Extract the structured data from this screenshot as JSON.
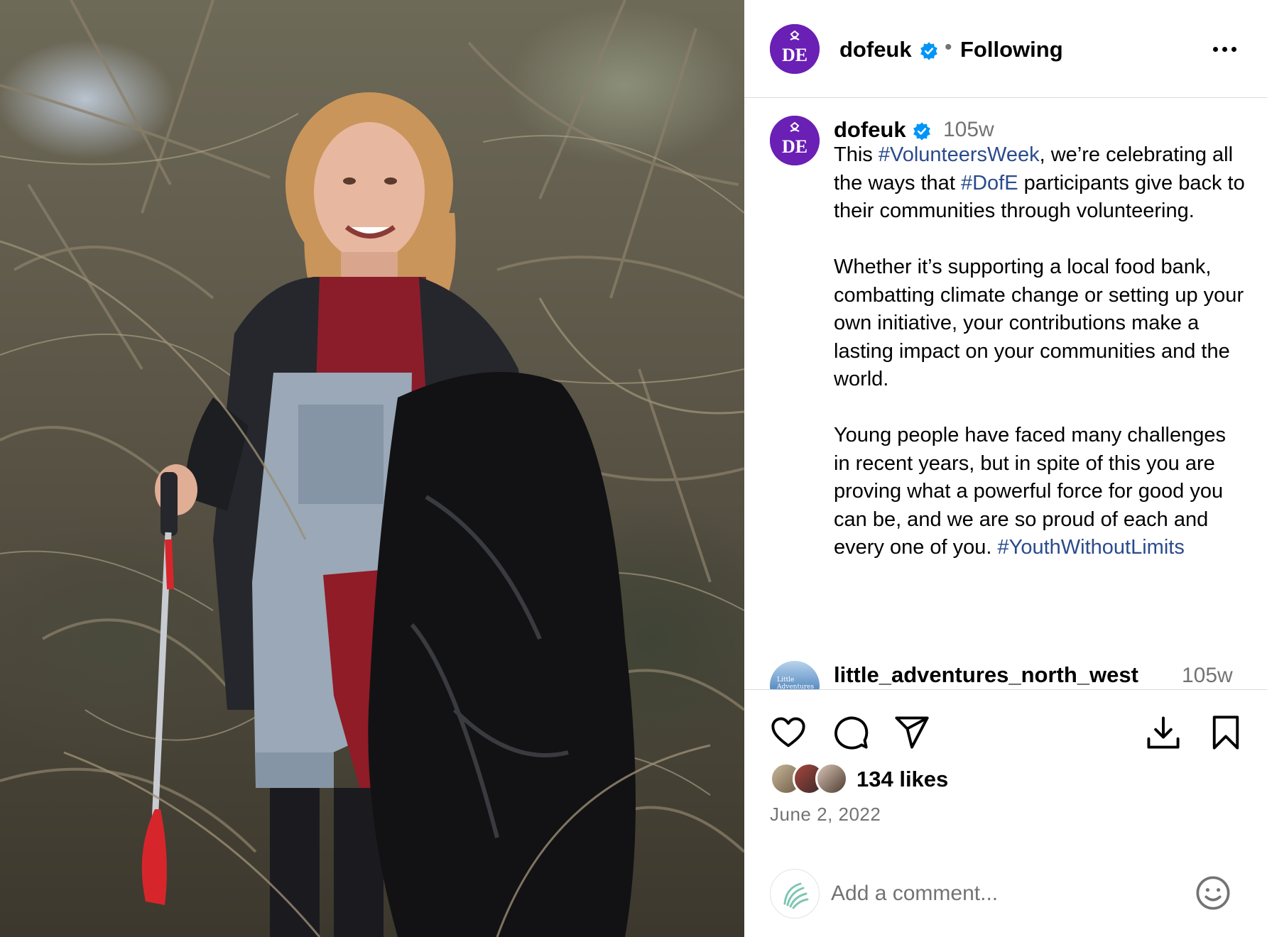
{
  "post": {
    "photo_alt": "Young woman with litter picker and black bag among bare brambles",
    "header": {
      "username": "dofeuk",
      "separator": "•",
      "follow_state": "Following"
    },
    "avatar_text": "DE",
    "caption": {
      "username": "dofeuk",
      "time": "105w",
      "parts": [
        {
          "t": "This ",
          "h": false
        },
        {
          "t": "#VolunteersWeek",
          "h": true
        },
        {
          "t": ", we’re celebrating all the ways that ",
          "h": false
        },
        {
          "t": "#DofE",
          "h": true
        },
        {
          "t": " participants give back to their communities through volunteering.\n\nWhether it’s supporting a local food bank, combatting climate change or setting up your own initiative, your contributions make a lasting impact on your communities and the world.\n\nYoung people have faced many challenges in recent years, but in spite of this you are proving what a powerful force for good you can be, and we are so proud of each and every one of you. ",
          "h": false
        },
        {
          "t": "#YouthWithoutLimits",
          "h": true
        }
      ]
    },
    "comment": {
      "username": "little_adventures_north_west",
      "time": "105w",
      "avatar_text": "Little\nAdventures"
    },
    "likes": "134 likes",
    "date": "June 2, 2022",
    "comment_input": {
      "placeholder": "Add a comment..."
    },
    "colors": {
      "accent_purple": "#6a1fb5",
      "hashtag": "#2a4b8c",
      "verified": "#0095f6",
      "muted": "#737373"
    }
  }
}
